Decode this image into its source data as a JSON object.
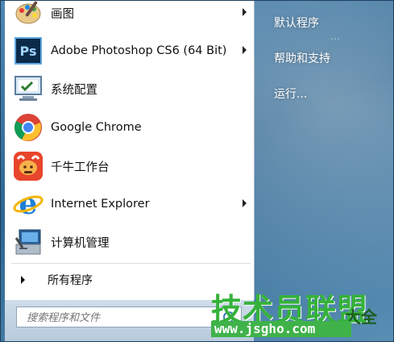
{
  "programs": [
    {
      "label": "画图",
      "icon": "paint-palette-icon",
      "has_submenu": true
    },
    {
      "label": "Adobe Photoshop CS6 (64 Bit)",
      "icon": "photoshop-icon",
      "icon_text": "Ps",
      "has_submenu": true
    },
    {
      "label": "系统配置",
      "icon": "system-config-icon",
      "has_submenu": false
    },
    {
      "label": "Google Chrome",
      "icon": "chrome-icon",
      "has_submenu": false
    },
    {
      "label": "千牛工作台",
      "icon": "qianniu-icon",
      "has_submenu": false
    },
    {
      "label": "Internet Explorer",
      "icon": "internet-explorer-icon",
      "icon_text": "e",
      "has_submenu": true
    },
    {
      "label": "计算机管理",
      "icon": "computer-management-icon",
      "has_submenu": false
    }
  ],
  "all_programs_label": "所有程序",
  "search": {
    "placeholder": "搜索程序和文件"
  },
  "right_items": [
    {
      "label": "默认程序"
    },
    {
      "label": "帮助和支持"
    },
    {
      "label": "运行..."
    }
  ],
  "watermark": {
    "text": "技术员联盟",
    "text2": "大全",
    "url": "www.jsgho.com"
  },
  "colors": {
    "accent": "#3a79b8",
    "watermark_green": "#35b23a"
  }
}
